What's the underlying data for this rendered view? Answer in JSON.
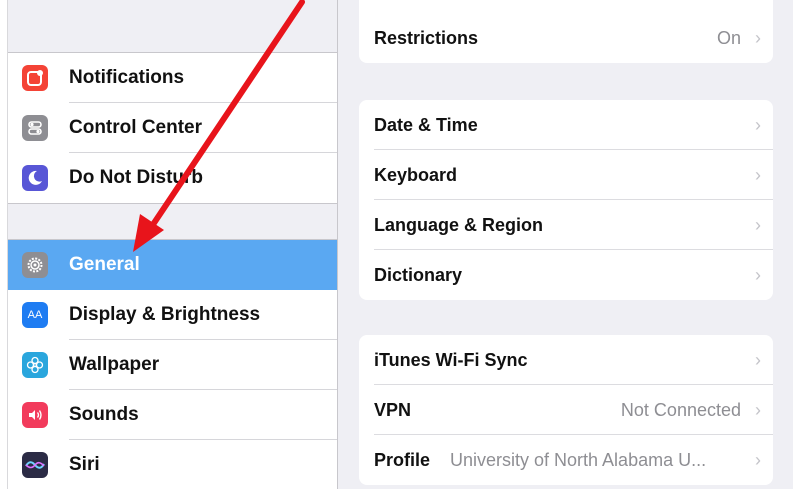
{
  "sidebar": {
    "items_group1": [
      {
        "label": "Notifications",
        "icon": "notifications-icon",
        "color": "#f44336"
      },
      {
        "label": "Control Center",
        "icon": "control-center-icon",
        "color": "#8e8e93"
      },
      {
        "label": "Do Not Disturb",
        "icon": "moon-icon",
        "color": "#5856d6"
      }
    ],
    "items_group2": [
      {
        "label": "General",
        "icon": "gear-icon",
        "color": "#8e8e93",
        "selected": true
      },
      {
        "label": "Display & Brightness",
        "icon": "display-brightness-icon",
        "color": "#1e7cf2",
        "icon_text": "AA"
      },
      {
        "label": "Wallpaper",
        "icon": "wallpaper-icon",
        "color": "#2aa6dd"
      },
      {
        "label": "Sounds",
        "icon": "speaker-icon",
        "color": "#f23b5c"
      },
      {
        "label": "Siri",
        "icon": "siri-icon",
        "color": "#2b2b45"
      }
    ],
    "selected_color": "#5aa8f2"
  },
  "main": {
    "restrictions": {
      "label": "Restrictions",
      "value": "On"
    },
    "group_a": [
      {
        "label": "Date & Time"
      },
      {
        "label": "Keyboard"
      },
      {
        "label": "Language & Region"
      },
      {
        "label": "Dictionary"
      }
    ],
    "group_b": [
      {
        "label": "iTunes Wi-Fi Sync",
        "value": ""
      },
      {
        "label": "VPN",
        "value": "Not Connected"
      },
      {
        "label": "Profile",
        "value": "University of North Alabama U..."
      }
    ],
    "chevron": "›"
  },
  "annotation": {
    "arrow_color": "#e8141b"
  }
}
